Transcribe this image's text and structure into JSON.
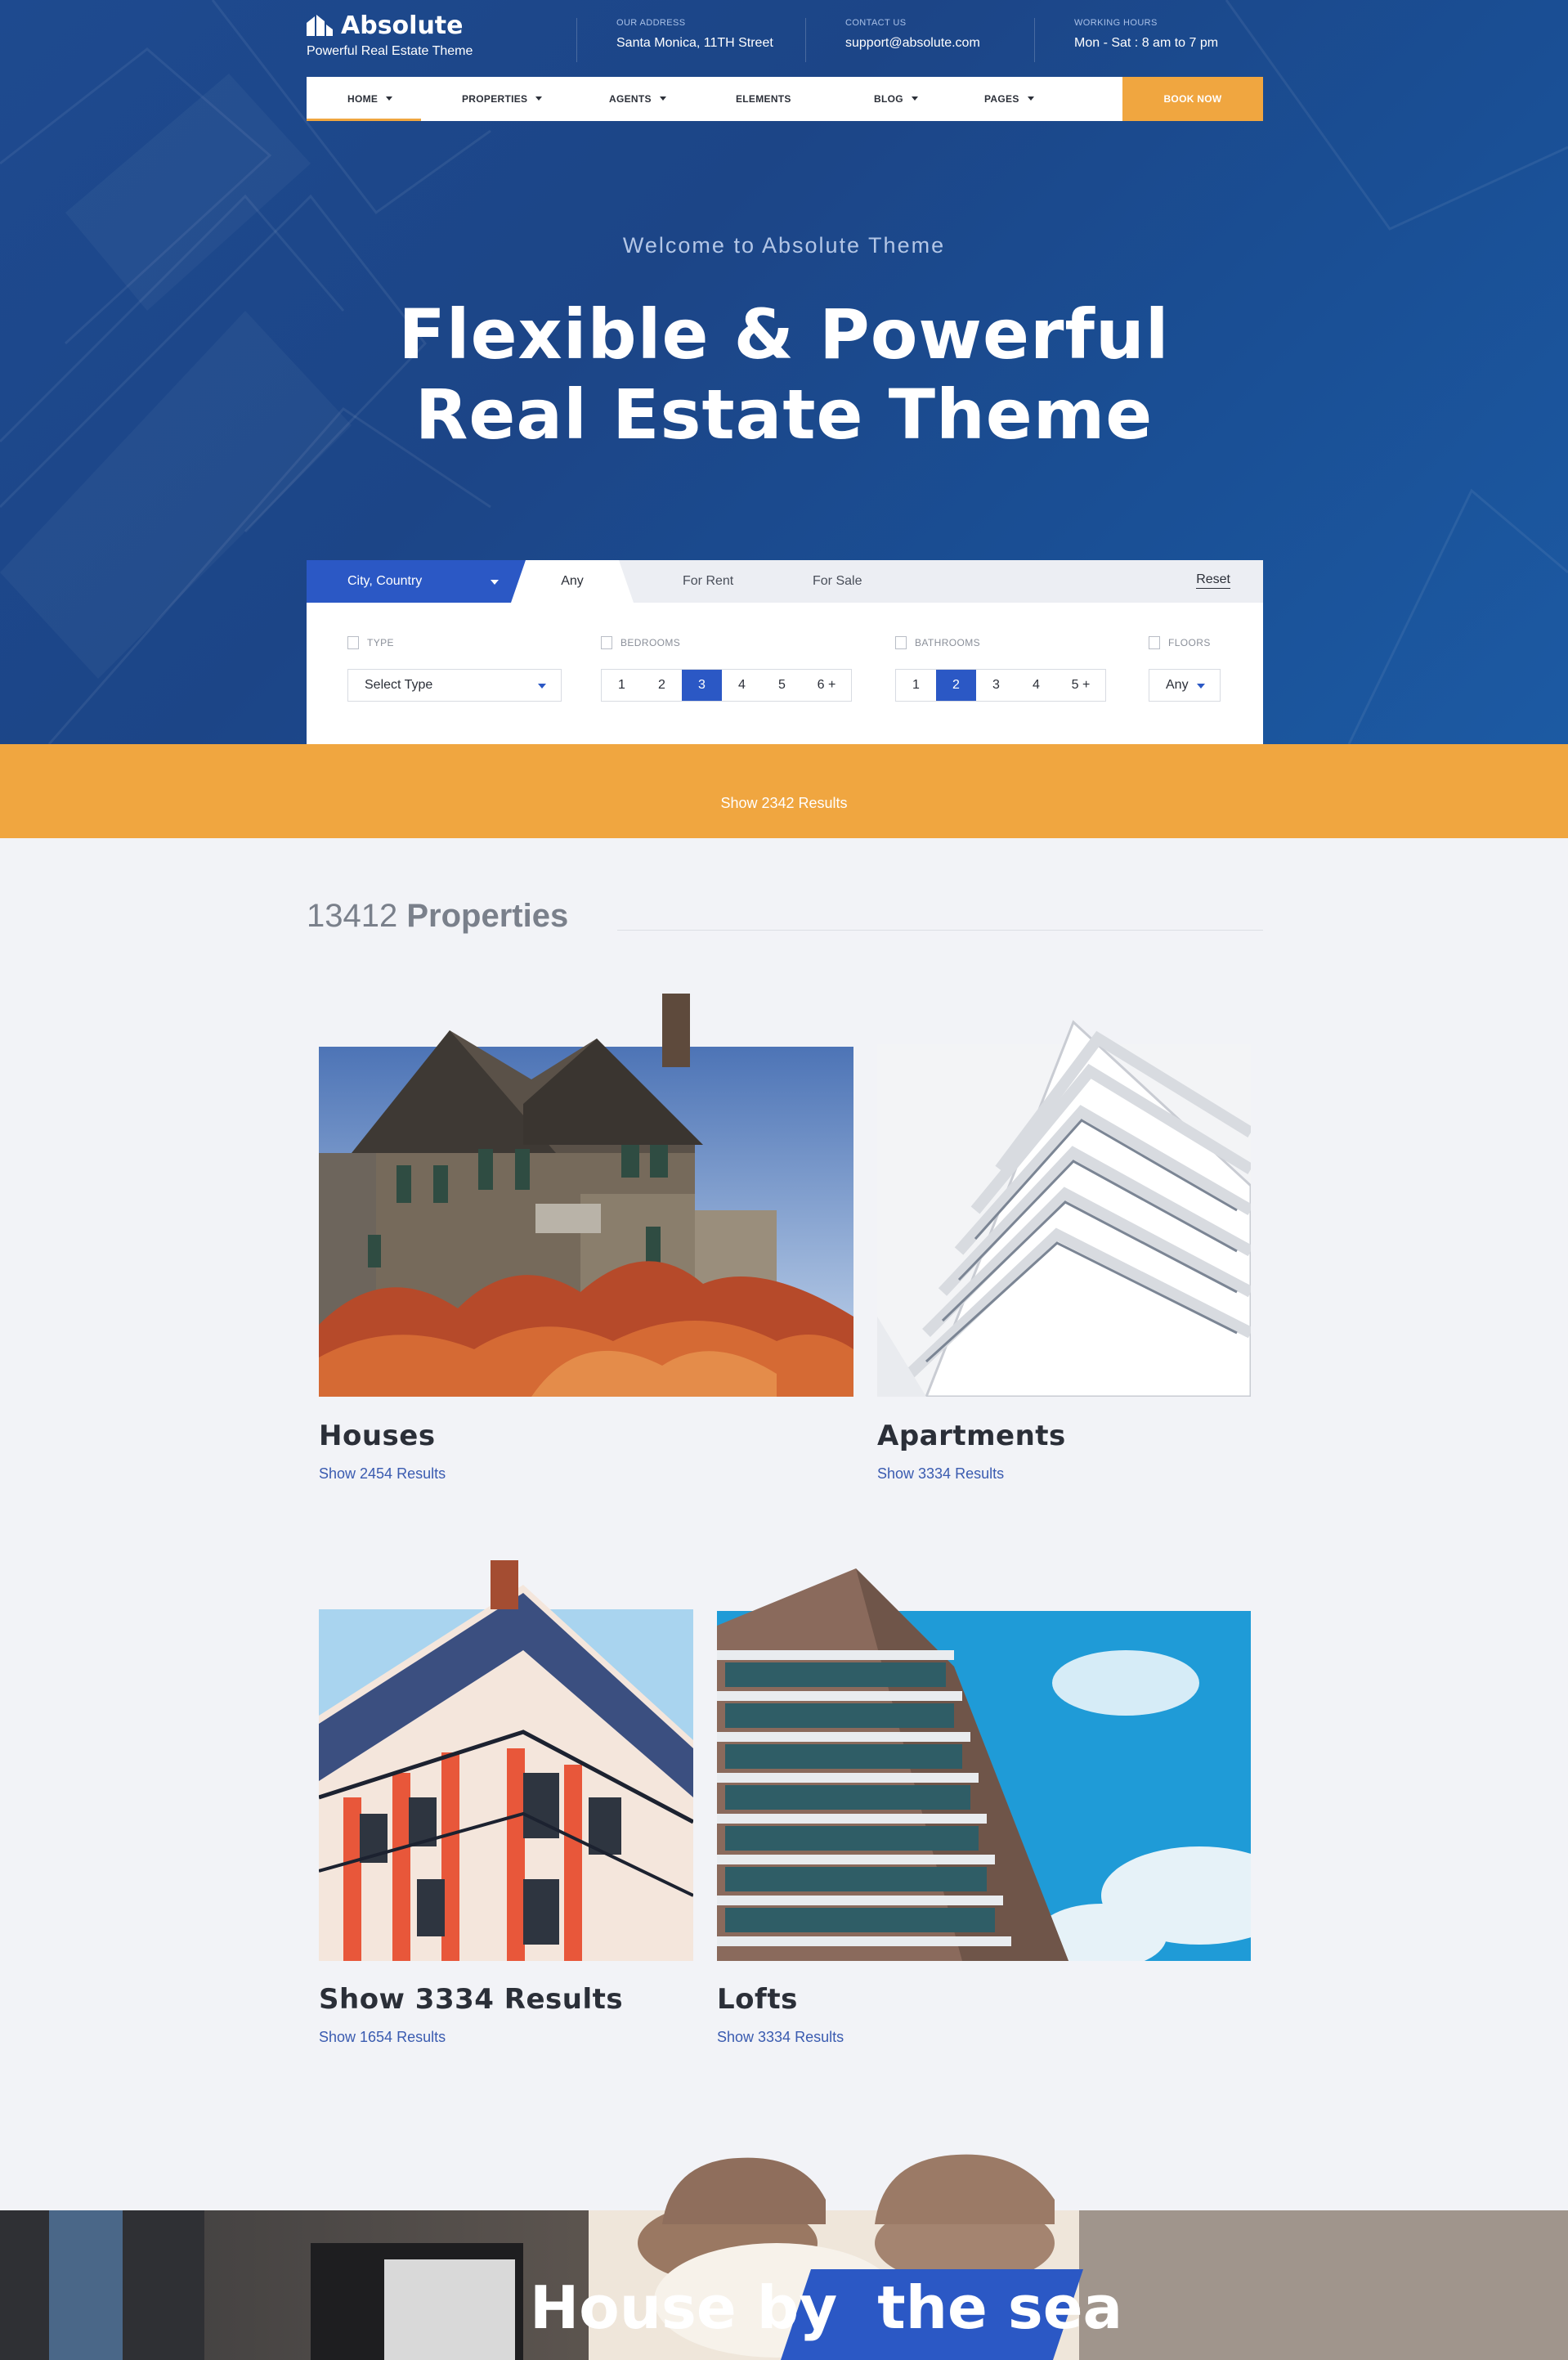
{
  "header": {
    "brand": "Absolute",
    "tagline": "Powerful Real Estate Theme",
    "address_label": "OUR ADDRESS",
    "address_value": "Santa Monica, 11TH Street",
    "contact_label": "CONTACT US",
    "contact_value": "support@absolute.com",
    "hours_label": "WORKING HOURS",
    "hours_value": "Mon - Sat : 8 am to 7 pm"
  },
  "nav": {
    "items": [
      "HOME",
      "PROPERTIES",
      "AGENTS",
      "ELEMENTS",
      "BLOG",
      "PAGES"
    ],
    "book_label": "BOOK NOW"
  },
  "hero": {
    "welcome": "Welcome to Absolute Theme",
    "headline_line1": "Flexible & Powerful",
    "headline_line2": "Real Estate Theme"
  },
  "search": {
    "location": "City, Country",
    "tabs": [
      "Any",
      "For Rent",
      "For Sale"
    ],
    "reset": "Reset",
    "type_label": "TYPE",
    "type_value": "Select Type",
    "bedrooms_label": "BEDROOMS",
    "bedrooms": [
      "1",
      "2",
      "3",
      "4",
      "5",
      "6 +"
    ],
    "bedrooms_selected": "3",
    "bathrooms_label": "BATHROOMS",
    "bathrooms": [
      "1",
      "2",
      "3",
      "4",
      "5 +"
    ],
    "bathrooms_selected": "2",
    "floors_label": "FLOORS",
    "floors_value": "Any",
    "results_button": "Show 2342 Results"
  },
  "properties": {
    "count_number": "13412",
    "count_label": "Properties",
    "cards": [
      {
        "title": "Houses",
        "link": "Show 2454 Results"
      },
      {
        "title": "Apartments",
        "link": "Show 3334 Results"
      },
      {
        "title": "Show 3334 Results",
        "link": "Show 1654 Results"
      },
      {
        "title": "Lofts",
        "link": "Show 3334 Results"
      }
    ]
  },
  "feature": {
    "title_part1": "House by",
    "title_part2": "the sea"
  },
  "colors": {
    "primary": "#2b58c5",
    "accent": "#f0a640",
    "hero_bg": "#1c4587"
  }
}
